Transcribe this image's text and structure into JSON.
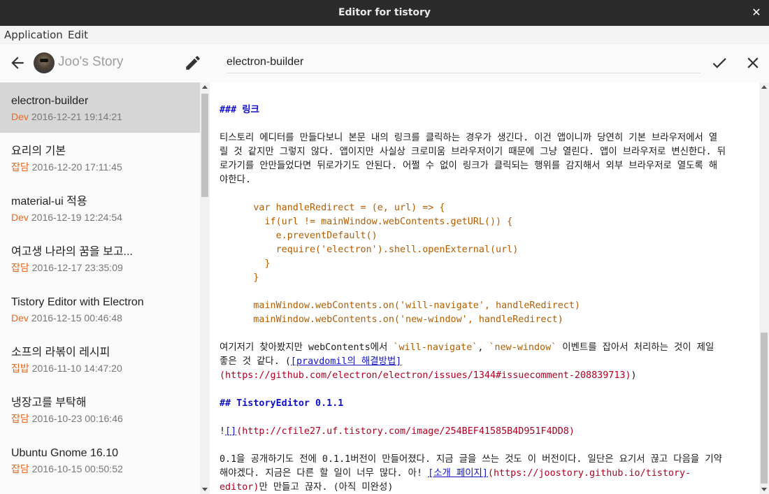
{
  "window": {
    "title": "Editor for tistory",
    "close_glyph": "✕"
  },
  "menu": {
    "items": [
      "Application",
      "Edit"
    ]
  },
  "sidebar": {
    "blog_title": "Joo's Story",
    "posts": [
      {
        "title": "electron-builder",
        "category": "Dev",
        "date": "2016-12-21 19:14:21"
      },
      {
        "title": "요리의 기본",
        "category": "잡담",
        "date": "2016-12-20 17:11:45"
      },
      {
        "title": "material-ui 적용",
        "category": "Dev",
        "date": "2016-12-19 12:24:54"
      },
      {
        "title": "여고생 나라의 꿈을 보고...",
        "category": "잡담",
        "date": "2016-12-17 23:35:09"
      },
      {
        "title": "Tistory Editor with Electron",
        "category": "Dev",
        "date": "2016-12-15 00:46:48"
      },
      {
        "title": "소프의 라볶이 레시피",
        "category": "집밥",
        "date": "2016-11-10 14:47:20"
      },
      {
        "title": "냉장고를 부탁해",
        "category": "잡담",
        "date": "2016-10-23 00:16:46"
      },
      {
        "title": "Ubuntu Gnome 16.10",
        "category": "잡담",
        "date": "2016-10-15 00:50:52"
      }
    ]
  },
  "editor": {
    "post_title": "electron-builder",
    "heading_link": "### 링크",
    "para1": [
      "티스토리 에디터를 만들다보니 본문 내의 링크를 클릭하는 경우가 생긴다. 이건 앱이니까 당연히 기본 브라우저에서 열",
      "릴 것 같지만 그렇지 않다. 앱이지만 사실상 크로미움 브라우저이기 때문에 그냥 열린다. 앱이 브라우저로 변신한다. 뒤",
      "로가기를 안만들었다면 뒤로가기도 안된다. 어쩔 수 없이 링크가 클릭되는 행위를 감지해서 외부 브라우저로 열도록 해",
      "야한다."
    ],
    "code1": [
      "      var handleRedirect = (e, url) => {",
      "        if(url != mainWindow.webContents.getURL()) {",
      "          e.preventDefault()",
      "          require('electron').shell.openExternal(url)",
      "        }",
      "      }"
    ],
    "code2": [
      "      mainWindow.webContents.on('will-navigate', handleRedirect)",
      "      mainWindow.webContents.on('new-window', handleRedirect)"
    ],
    "para2": {
      "p1": "여기저기 찾아봤지만 webContents에서 ",
      "c1": "`will-navigate`",
      "p2": ", ",
      "c2": "`new-window`",
      "p3": " 이벤트를 잡아서 처리하는 것이 제일",
      "p4": "좋은 것 같다. (",
      "link_text": "[pravdomil의 해결방법]",
      "url": "(https://github.com/electron/electron/issues/1344#issuecomment-208839713)",
      "close": ")"
    },
    "heading_version": "## TistoryEditor 0.1.1",
    "image": {
      "bang": "!",
      "link_text": "[]",
      "url": "(http://cfile27.uf.tistory.com/image/254BEF41585B4D951F4DD8)"
    },
    "para3": {
      "l1": "0.1을 공개하기도 전에 0.1.1버전이 만들어졌다. 지금 글을 쓰는 것도 이 버전이다. 일단은 요기서 끊고 다음을 기약",
      "l2": "해야겠다. 지금은 다른 할 일이 너무 많다. 아! ",
      "link_text": "[소개 페이지]",
      "url_a": "(https://joostory.github.io/tistory-",
      "url_b": "editor)",
      "tail": "만 만들고 끊자. (아직 미완성)"
    }
  },
  "icons": {
    "back": "arrow-left",
    "edit": "pencil",
    "confirm": "check",
    "cancel": "close"
  }
}
